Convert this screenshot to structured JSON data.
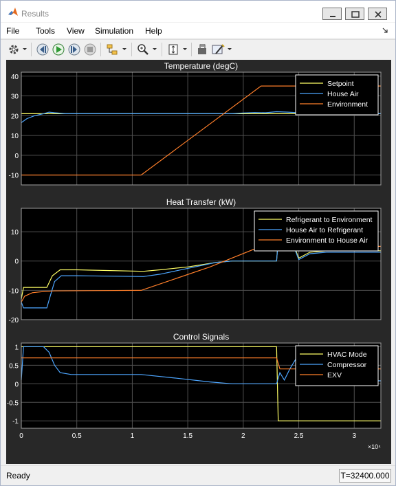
{
  "window": {
    "title": "Results"
  },
  "menu": [
    "File",
    "Tools",
    "View",
    "Simulation",
    "Help"
  ],
  "toolbar": {
    "icons": [
      "settings-icon",
      "step-back-icon",
      "run-icon",
      "stop-icon",
      "signal-select-icon",
      "zoom-icon",
      "fit-axes-icon",
      "write-icon",
      "style-icon"
    ]
  },
  "status": {
    "state": "Ready",
    "time": "T=32400.000"
  },
  "colors": {
    "yellow": "#ffff66",
    "blue": "#4da6ff",
    "orange": "#ff7f2a",
    "axes_bg": "#000000",
    "grid": "#505050",
    "figure_bg": "#282828",
    "text": "#ffffff"
  },
  "chart_data": [
    {
      "type": "line",
      "title": "Temperature (degC)",
      "ylim": [
        -15,
        42
      ],
      "yticks": [
        -10,
        0,
        10,
        20,
        30,
        40
      ],
      "xlim": [
        0,
        32400
      ],
      "legend": "top-right",
      "series": [
        {
          "name": "Setpoint",
          "color": "yellow",
          "x": [
            0,
            32400
          ],
          "y": [
            21,
            21
          ]
        },
        {
          "name": "House Air",
          "color": "blue",
          "x": [
            0,
            500,
            1200,
            2000,
            2500,
            3000,
            4000,
            6000,
            10000,
            15000,
            19000,
            20000,
            21000,
            22000,
            23000,
            24000,
            25000,
            26000,
            28000,
            32400
          ],
          "y": [
            16.5,
            18.5,
            20,
            21,
            21.8,
            21.5,
            21,
            21,
            21,
            21,
            21,
            21.4,
            21.6,
            21.5,
            22,
            21.8,
            21.5,
            21.3,
            21,
            21
          ]
        },
        {
          "name": "Environment",
          "color": "orange",
          "x": [
            0,
            10800,
            21600,
            32400
          ],
          "y": [
            -10,
            -10,
            35,
            35
          ]
        }
      ]
    },
    {
      "type": "line",
      "title": "Heat Transfer (kW)",
      "ylim": [
        -20,
        18
      ],
      "yticks": [
        -20,
        -10,
        0,
        10
      ],
      "xlim": [
        0,
        32400
      ],
      "legend": "top-right",
      "series": [
        {
          "name": "Refrigerant to Environment",
          "color": "yellow",
          "x": [
            0,
            200,
            2300,
            2800,
            3500,
            5000,
            11000,
            12500,
            15000,
            17500,
            19000,
            23000,
            23100,
            23400,
            23800,
            24500,
            25000,
            26000,
            27500,
            32400
          ],
          "y": [
            -13,
            -9,
            -9,
            -5,
            -3,
            -3,
            -3.5,
            -3,
            -2,
            -0.5,
            0,
            0,
            5,
            6,
            6.5,
            6,
            1,
            3,
            3.5,
            3.5
          ]
        },
        {
          "name": "House Air to Refrigerant",
          "color": "blue",
          "x": [
            0,
            200,
            2300,
            2600,
            3000,
            3600,
            5000,
            11000,
            12500,
            15000,
            17500,
            19000,
            23000,
            23100,
            23400,
            23800,
            24500,
            25000,
            26000,
            27500,
            32400
          ],
          "y": [
            -14,
            -16,
            -16,
            -12,
            -7,
            -5,
            -5,
            -5.3,
            -4.5,
            -2.5,
            -0.5,
            0,
            0,
            4.5,
            5.5,
            6,
            5.5,
            0.5,
            2.5,
            3,
            3
          ]
        },
        {
          "name": "Environment to House Air",
          "color": "orange",
          "x": [
            0,
            300,
            1000,
            2000,
            3000,
            6000,
            10800,
            17000,
            21600,
            32400
          ],
          "y": [
            -14,
            -12,
            -10.8,
            -10.4,
            -10.2,
            -10.1,
            -10,
            -2,
            5,
            5
          ]
        }
      ]
    },
    {
      "type": "line",
      "title": "Control Signals",
      "ylim": [
        -1.2,
        1.1
      ],
      "yticks": [
        -1,
        -0.5,
        0,
        0.5,
        1
      ],
      "xlim": [
        0,
        32400
      ],
      "xticks": [
        0,
        5000,
        10000,
        15000,
        20000,
        25000,
        30000
      ],
      "xtick_labels": [
        "0",
        "0.5",
        "1",
        "1.5",
        "2",
        "2.5",
        "3"
      ],
      "x_exponent": "×10⁴",
      "legend": "top-right",
      "series": [
        {
          "name": "HVAC Mode",
          "color": "yellow",
          "x": [
            0,
            23000,
            23150,
            32400
          ],
          "y": [
            1,
            1,
            -1,
            -1
          ]
        },
        {
          "name": "Compressor",
          "color": "blue",
          "x": [
            0,
            200,
            2000,
            2500,
            3000,
            3500,
            4500,
            10800,
            14000,
            17000,
            19000,
            23000,
            23300,
            23700,
            24200,
            24800,
            25500,
            26500,
            28000,
            32400
          ],
          "y": [
            0.1,
            1,
            1,
            0.85,
            0.5,
            0.3,
            0.25,
            0.25,
            0.15,
            0.05,
            0,
            0,
            0.3,
            0.1,
            0.4,
            0.7,
            0.2,
            0.05,
            0.08,
            0.08
          ]
        },
        {
          "name": "EXV",
          "color": "orange",
          "x": [
            0,
            23000,
            23300,
            32400
          ],
          "y": [
            0.7,
            0.7,
            0.4,
            0.4
          ]
        }
      ]
    }
  ]
}
